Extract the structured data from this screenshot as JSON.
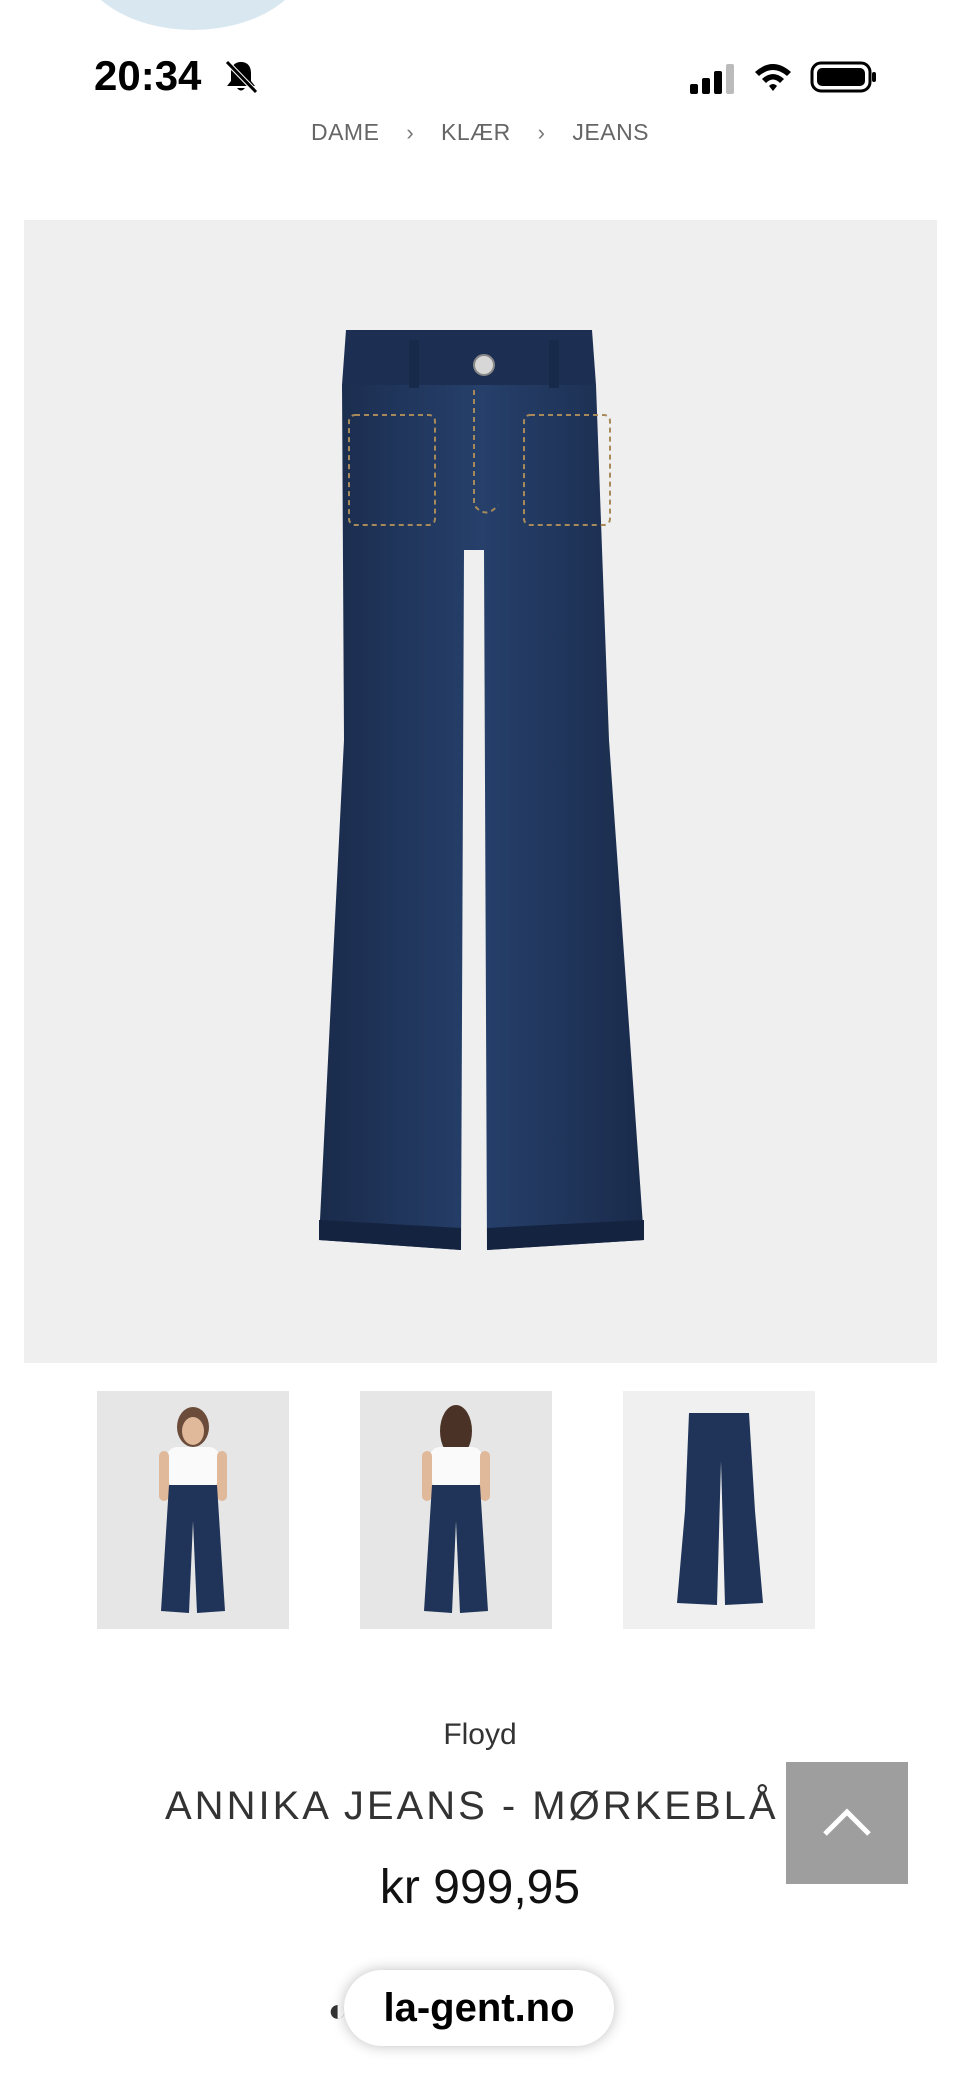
{
  "status_bar": {
    "time": "20:34",
    "icons": [
      "bell-off-icon",
      "signal-icon",
      "wifi-icon",
      "battery-icon"
    ]
  },
  "breadcrumb": {
    "items": [
      "DAME",
      "KLÆR",
      "JEANS"
    ],
    "separator": "›"
  },
  "product": {
    "brand": "Floyd",
    "title": "ANNIKA JEANS - MØRKEBLÅ",
    "price": "kr 999,95",
    "main_image": "dark-blue-flared-jeans",
    "thumbnails": [
      "model-front",
      "model-back",
      "jeans-flat"
    ]
  },
  "colors": {
    "denim": "#1f3458",
    "image_bg": "#efefef",
    "scroll_button": "#9e9e9e",
    "breadcrumb_text": "#666666"
  },
  "scroll_top": {
    "icon": "chevron-up-icon"
  },
  "browser": {
    "url": "la-gent.no"
  }
}
